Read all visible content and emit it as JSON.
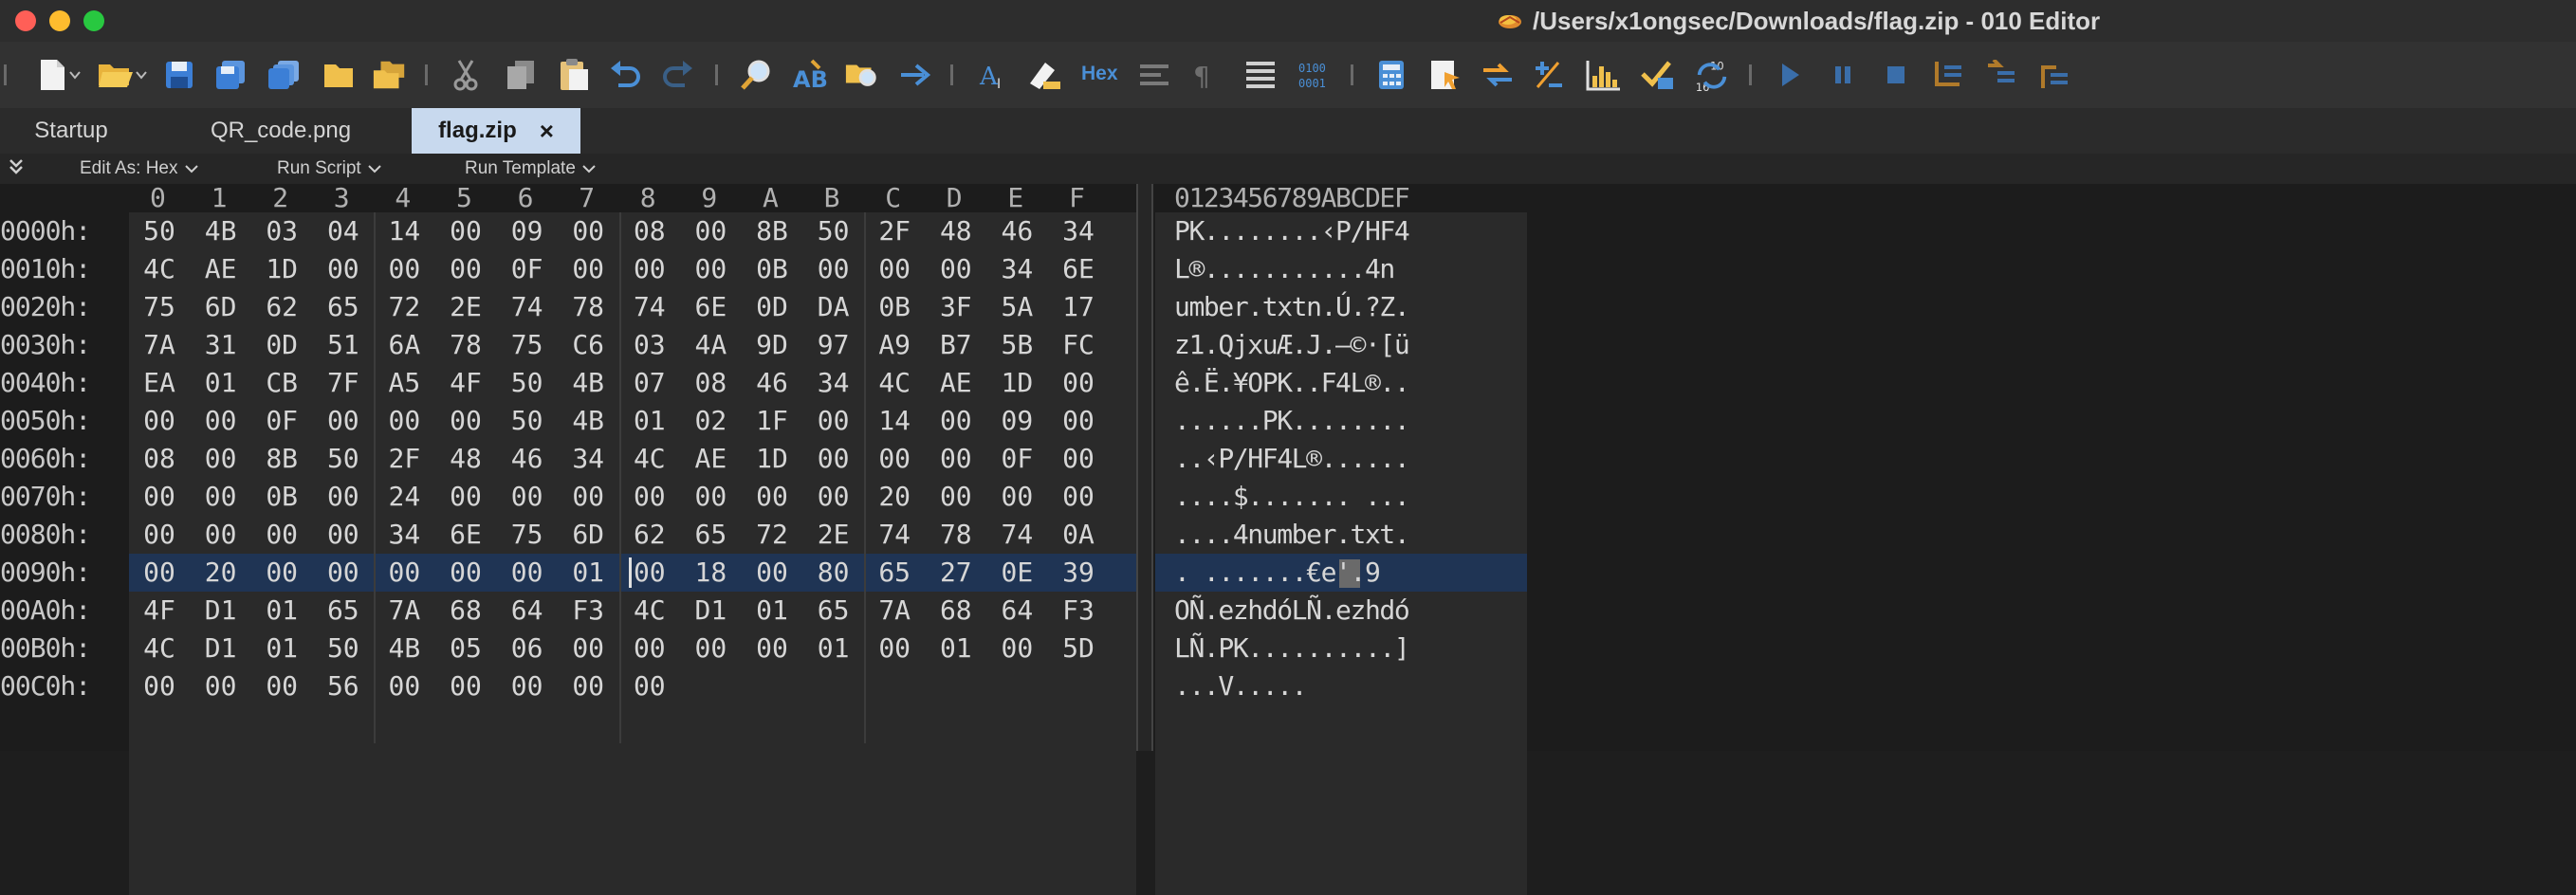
{
  "window": {
    "title": "/Users/x1ongsec/Downloads/flag.zip - 010 Editor"
  },
  "toolbar": {
    "hex_label": "Hex",
    "icons": [
      "new-file",
      "open-file",
      "save",
      "save-as",
      "save-all",
      "open-folder",
      "open-workspace",
      "cut",
      "copy",
      "paste",
      "undo",
      "redo",
      "find",
      "replace",
      "find-in-files",
      "goto",
      "text-format",
      "highlight",
      "hex-mode",
      "compare",
      "paragraph",
      "columns",
      "binary",
      "calculator",
      "inspector",
      "swap",
      "plus-minus",
      "histogram",
      "checksum",
      "number-convert",
      "run",
      "pause",
      "stop",
      "step-in",
      "step-over",
      "step-out"
    ]
  },
  "tabs": [
    {
      "label": "Startup",
      "active": false
    },
    {
      "label": "QR_code.png",
      "active": false
    },
    {
      "label": "flag.zip",
      "active": true,
      "close": "×"
    }
  ],
  "editbar": {
    "edit_as": "Edit As: Hex",
    "run_script": "Run Script",
    "run_template": "Run Template"
  },
  "hex": {
    "col_headers": [
      "0",
      "1",
      "2",
      "3",
      "4",
      "5",
      "6",
      "7",
      "8",
      "9",
      "A",
      "B",
      "C",
      "D",
      "E",
      "F"
    ],
    "ascii_header": "0123456789ABCDEF",
    "selected_row": 9,
    "cursor_col": 8,
    "ascii_highlight_col": 8,
    "rows": [
      {
        "addr": "0000h:",
        "bytes": [
          "50",
          "4B",
          "03",
          "04",
          "14",
          "00",
          "09",
          "00",
          "08",
          "00",
          "8B",
          "50",
          "2F",
          "48",
          "46",
          "34"
        ],
        "ascii": "PK........‹P/HF4"
      },
      {
        "addr": "0010h:",
        "bytes": [
          "4C",
          "AE",
          "1D",
          "00",
          "00",
          "00",
          "0F",
          "00",
          "00",
          "00",
          "0B",
          "00",
          "00",
          "00",
          "34",
          "6E"
        ],
        "ascii": "L®...........4n"
      },
      {
        "addr": "0020h:",
        "bytes": [
          "75",
          "6D",
          "62",
          "65",
          "72",
          "2E",
          "74",
          "78",
          "74",
          "6E",
          "0D",
          "DA",
          "0B",
          "3F",
          "5A",
          "17"
        ],
        "ascii": "umber.txtn.Ú.?Z."
      },
      {
        "addr": "0030h:",
        "bytes": [
          "7A",
          "31",
          "0D",
          "51",
          "6A",
          "78",
          "75",
          "C6",
          "03",
          "4A",
          "9D",
          "97",
          "A9",
          "B7",
          "5B",
          "FC"
        ],
        "ascii": "z1.QjxuÆ.J.—©·[ü"
      },
      {
        "addr": "0040h:",
        "bytes": [
          "EA",
          "01",
          "CB",
          "7F",
          "A5",
          "4F",
          "50",
          "4B",
          "07",
          "08",
          "46",
          "34",
          "4C",
          "AE",
          "1D",
          "00"
        ],
        "ascii": "ê.Ë.¥OPK..F4L®.."
      },
      {
        "addr": "0050h:",
        "bytes": [
          "00",
          "00",
          "0F",
          "00",
          "00",
          "00",
          "50",
          "4B",
          "01",
          "02",
          "1F",
          "00",
          "14",
          "00",
          "09",
          "00"
        ],
        "ascii": "......PK........"
      },
      {
        "addr": "0060h:",
        "bytes": [
          "08",
          "00",
          "8B",
          "50",
          "2F",
          "48",
          "46",
          "34",
          "4C",
          "AE",
          "1D",
          "00",
          "00",
          "00",
          "0F",
          "00"
        ],
        "ascii": "..‹P/HF4L®......"
      },
      {
        "addr": "0070h:",
        "bytes": [
          "00",
          "00",
          "0B",
          "00",
          "24",
          "00",
          "00",
          "00",
          "00",
          "00",
          "00",
          "00",
          "20",
          "00",
          "00",
          "00"
        ],
        "ascii": "....$....... ..."
      },
      {
        "addr": "0080h:",
        "bytes": [
          "00",
          "00",
          "00",
          "00",
          "34",
          "6E",
          "75",
          "6D",
          "62",
          "65",
          "72",
          "2E",
          "74",
          "78",
          "74",
          "0A"
        ],
        "ascii": "....4number.txt."
      },
      {
        "addr": "0090h:",
        "bytes": [
          "00",
          "20",
          "00",
          "00",
          "00",
          "00",
          "00",
          "01",
          "00",
          "18",
          "00",
          "80",
          "65",
          "27",
          "0E",
          "39"
        ],
        "ascii": ". .......€e'.9"
      },
      {
        "addr": "00A0h:",
        "bytes": [
          "4F",
          "D1",
          "01",
          "65",
          "7A",
          "68",
          "64",
          "F3",
          "4C",
          "D1",
          "01",
          "65",
          "7A",
          "68",
          "64",
          "F3"
        ],
        "ascii": "OÑ.ezhdóLÑ.ezhdó"
      },
      {
        "addr": "00B0h:",
        "bytes": [
          "4C",
          "D1",
          "01",
          "50",
          "4B",
          "05",
          "06",
          "00",
          "00",
          "00",
          "00",
          "01",
          "00",
          "01",
          "00",
          "5D"
        ],
        "ascii": "LÑ.PK..........]"
      },
      {
        "addr": "00C0h:",
        "bytes": [
          "00",
          "00",
          "00",
          "56",
          "00",
          "00",
          "00",
          "00",
          "00"
        ],
        "ascii": "...V....."
      }
    ]
  }
}
